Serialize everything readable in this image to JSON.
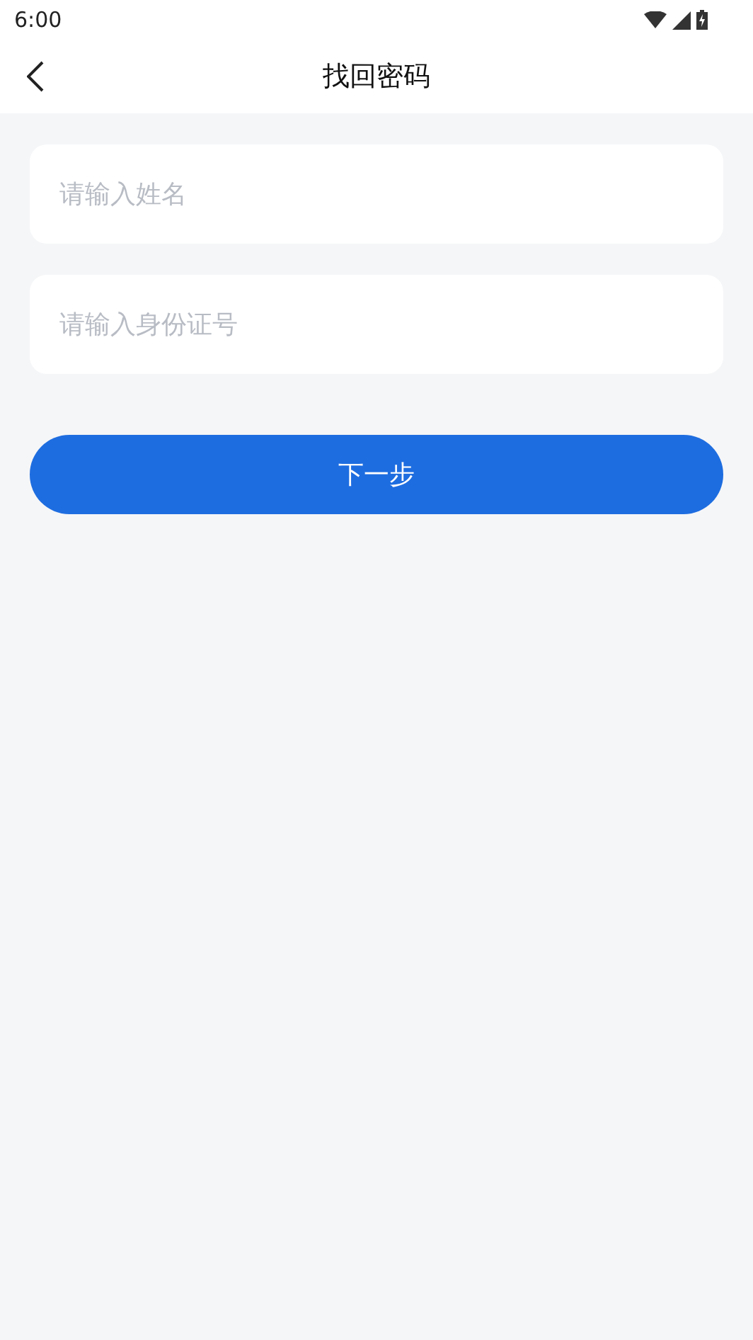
{
  "status_bar": {
    "time": "6:00"
  },
  "header": {
    "title": "找回密码"
  },
  "fields": [
    {
      "placeholder": "请输入姓名"
    },
    {
      "placeholder": "请输入身份证号"
    }
  ],
  "primary_button": {
    "label": "下一步"
  }
}
